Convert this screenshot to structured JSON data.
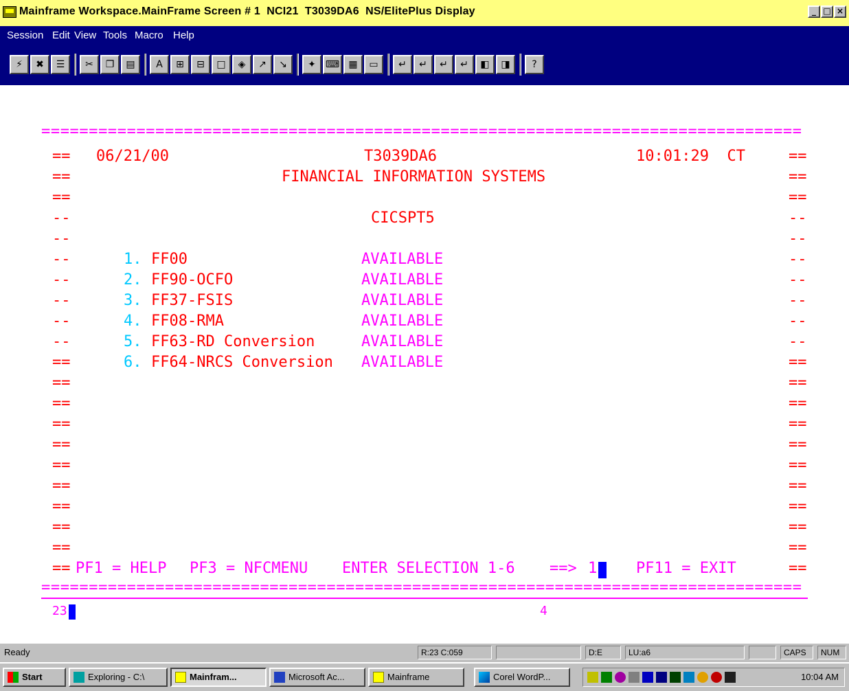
{
  "window": {
    "title": "Mainframe Workspace.MainFrame Screen # 1  NCI21  T3039DA6  NS/ElitePlus Display",
    "min_label": "_",
    "max_label": "□",
    "close_label": "×"
  },
  "menu": [
    "Session",
    "Edit",
    "View",
    "Tools",
    "Macro",
    "Help"
  ],
  "terminal": {
    "border_line": "================================================================================",
    "date": "06/21/00",
    "terminal_id": "T3039DA6",
    "time": "10:01:29  CT",
    "heading": "FINANCIAL INFORMATION SYSTEMS",
    "subheading": "CICSPT5",
    "left_marks_eq": "==",
    "left_marks_dash": "--",
    "options": [
      {
        "num": "1.",
        "name": "FF00",
        "status": "AVAILABLE"
      },
      {
        "num": "2.",
        "name": "FF90-OCFO",
        "status": "AVAILABLE"
      },
      {
        "num": "3.",
        "name": "FF37-FSIS",
        "status": "AVAILABLE"
      },
      {
        "num": "4.",
        "name": "FF08-RMA",
        "status": "AVAILABLE"
      },
      {
        "num": "5.",
        "name": "FF63-RD Conversion",
        "status": "AVAILABLE"
      },
      {
        "num": "6.",
        "name": "FF64-NRCS Conversion",
        "status": "AVAILABLE"
      }
    ],
    "prompt_prefix": "==",
    "pf1": "PF1 = HELP",
    "pf3": "PF3 = NFCMENU",
    "enter_selection": "ENTER SELECTION 1-6",
    "arrow": "==>",
    "selection_value": "1",
    "pf11": "PF11 = EXIT",
    "row_num": "23",
    "col_marker": "4"
  },
  "status": {
    "ready": "Ready",
    "position": "R:23 C:059",
    "field3": "",
    "de": "D:E",
    "lu": "LU:a6",
    "blank": "",
    "caps": "CAPS",
    "num": "NUM"
  },
  "taskbar": {
    "start": "Start",
    "tasks": [
      "Exploring - C:\\",
      "Mainfram...",
      "Microsoft Ac...",
      "Mainframe",
      "Corel WordP..."
    ],
    "clock": "10:04 AM"
  }
}
